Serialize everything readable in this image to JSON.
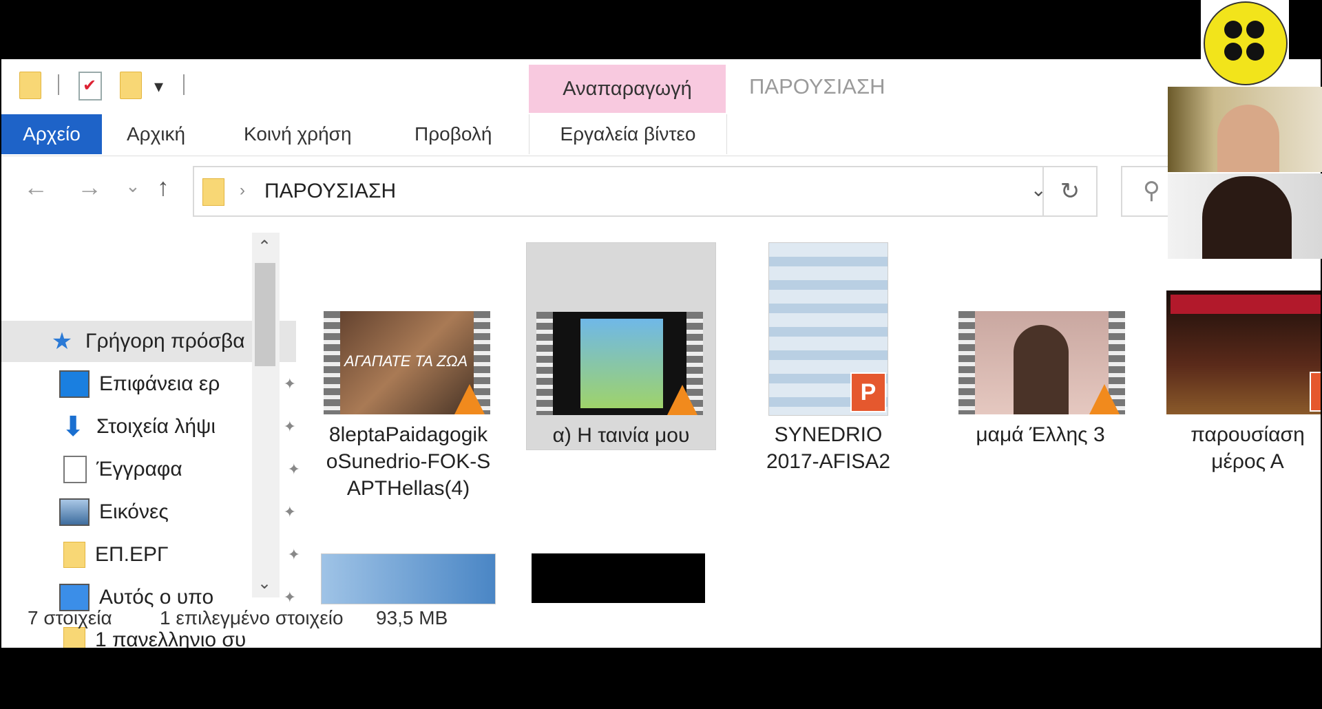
{
  "qat": {
    "icons": [
      "folder-icon",
      "properties-check-icon",
      "new-folder-icon"
    ],
    "customize": "▾"
  },
  "context_tab_group": "Αναπαραγωγή",
  "window_title": "ΠΑΡΟΥΣΙΑΣΗ",
  "tabs": [
    {
      "label": "Αρχείο"
    },
    {
      "label": "Αρχική"
    },
    {
      "label": "Κοινή χρήση"
    },
    {
      "label": "Προβολή"
    },
    {
      "label": "Εργαλεία βίντεο"
    }
  ],
  "address": {
    "separator": "›",
    "path": "ΠΑΡΟΥΣΙΑΣΗ"
  },
  "nav": {
    "back": "←",
    "forward": "→",
    "recent": "⌄",
    "up": "↑",
    "refresh": "↻",
    "search": "⚲"
  },
  "sidebar": {
    "items": [
      {
        "label": "Γρήγορη πρόσβα",
        "icon": "quick-access-star-icon",
        "pinned": false,
        "selected": true
      },
      {
        "label": "Επιφάνεια ερ",
        "icon": "desktop-icon",
        "pinned": true
      },
      {
        "label": "Στοιχεία λήψι",
        "icon": "downloads-arrow-icon",
        "pinned": true
      },
      {
        "label": "Έγγραφα",
        "icon": "documents-icon",
        "pinned": true
      },
      {
        "label": "Εικόνες",
        "icon": "pictures-icon",
        "pinned": true
      },
      {
        "label": "ΕΠ.ΕΡΓ",
        "icon": "folder-icon",
        "pinned": true
      },
      {
        "label": "Αυτός ο υπο",
        "icon": "this-pc-icon",
        "pinned": true
      },
      {
        "label": "1 πανελληνιο συ",
        "icon": "folder-icon",
        "pinned": false
      }
    ],
    "scroll_up": "⌃",
    "scroll_down": "⌄"
  },
  "files": [
    {
      "name_lines": [
        "8leptaPaidagogik",
        "oSunedrio-FOK-S",
        "APTHellas(4)"
      ],
      "type": "video",
      "thumb_text": "ΑΓΑΠΑΤΕ ΤΑ ΖΩΑ"
    },
    {
      "name_lines": [
        "α) Η ταινία μου"
      ],
      "type": "video",
      "selected": true
    },
    {
      "name_lines": [
        "SYNEDRIO",
        "2017-AFISA2"
      ],
      "type": "pptx",
      "badge": "P"
    },
    {
      "name_lines": [
        "μαμά Έλλης 3"
      ],
      "type": "video"
    },
    {
      "name_lines": [
        "παρουσίαση",
        "μέρος Α"
      ],
      "type": "pptx",
      "badge": "P"
    }
  ],
  "status": {
    "count": "7 στοιχεία",
    "selection": "1 επιλεγμένο στοιχείο",
    "size": "93,5 MB"
  },
  "pin_glyph": "📌"
}
